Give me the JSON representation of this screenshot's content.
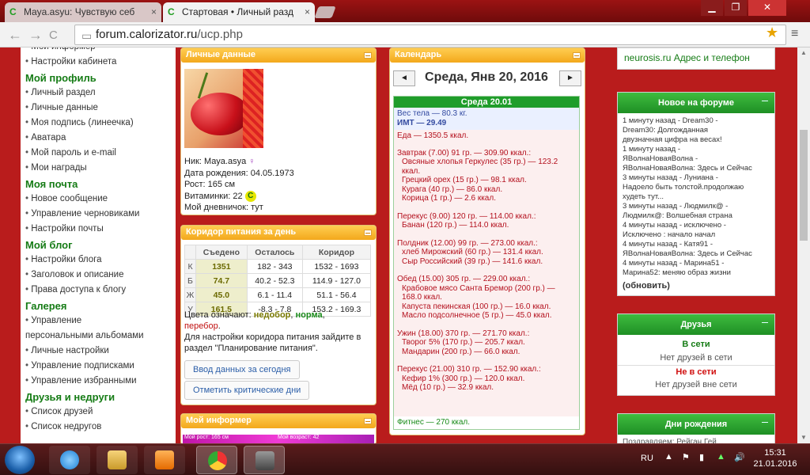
{
  "browser": {
    "tabs": [
      {
        "title": "Maya.asyu: Чувствую себ",
        "active": false
      },
      {
        "title": "Стартовая • Личный разд",
        "active": true
      }
    ],
    "url_domain": "forum.calorizator.ru",
    "url_path": "/ucp.php",
    "tab_close": "×",
    "fav_letter": "C",
    "minimize": "▁",
    "restore": "❐",
    "close": "✕",
    "back": "←",
    "forward": "→",
    "reload": "C",
    "star": "★",
    "menu": "≡",
    "page_icon": "▭"
  },
  "sidebar": {
    "items": [
      {
        "type": "item",
        "label": "Мой информер"
      },
      {
        "type": "item",
        "label": "Настройки кабинета"
      },
      {
        "type": "head",
        "label": "Мой профиль"
      },
      {
        "type": "item",
        "label": "Личный раздел"
      },
      {
        "type": "item",
        "label": "Личные данные"
      },
      {
        "type": "item",
        "label": "Моя подпись (линеечка)"
      },
      {
        "type": "item",
        "label": "Аватара"
      },
      {
        "type": "item",
        "label": "Мой пароль и e-mail"
      },
      {
        "type": "item",
        "label": "Мои награды"
      },
      {
        "type": "head",
        "label": "Моя почта"
      },
      {
        "type": "item",
        "label": "Новое сообщение"
      },
      {
        "type": "item",
        "label": "Управление черновиками"
      },
      {
        "type": "item",
        "label": "Настройки почты"
      },
      {
        "type": "head",
        "label": "Мой блог"
      },
      {
        "type": "item",
        "label": "Настройки блога"
      },
      {
        "type": "item",
        "label": "Заголовок и описание"
      },
      {
        "type": "item",
        "label": "Права доступа к блогу"
      },
      {
        "type": "head",
        "label": "Галерея"
      },
      {
        "type": "item",
        "label": "Управление"
      },
      {
        "type": "plain",
        "label": "персональными альбомами"
      },
      {
        "type": "item",
        "label": "Личные настройки"
      },
      {
        "type": "item",
        "label": "Управление подписками"
      },
      {
        "type": "item",
        "label": "Управление избранными"
      },
      {
        "type": "head",
        "label": "Друзья и недруги"
      },
      {
        "type": "item",
        "label": "Список друзей"
      },
      {
        "type": "item",
        "label": "Список недругов"
      }
    ]
  },
  "personal": {
    "title": "Личные данные",
    "nick_label": "Ник:",
    "nick": "Maya.asya",
    "fem": "♀",
    "birth_label": "Дата рождения:",
    "birth": "04.05.1973",
    "height_label": "Рост:",
    "height": "165 см",
    "vit_label": "Витаминки:",
    "vit": "22",
    "vit_icon": "C",
    "diary_label": "Мой дневничок:",
    "diary": "тут"
  },
  "corridor": {
    "title": "Коридор питания за день",
    "headers": [
      "",
      "Съедено",
      "Осталось",
      "Коридор"
    ],
    "rows": [
      {
        "k": "К",
        "eaten": "1351",
        "left": "182  -  343",
        "range": "1532  -  1693"
      },
      {
        "k": "Б",
        "eaten": "74.7",
        "left": "40.2  -  52.3",
        "range": "114.9  -  127.0"
      },
      {
        "k": "Ж",
        "eaten": "45.0",
        "left": "6.1  -  11.4",
        "range": "51.1  -  56.4"
      },
      {
        "k": "У",
        "eaten": "161.5",
        "left": "-8.3  -  7.8",
        "range": "153.2  -  169.3"
      }
    ],
    "legend_prefix": "Цвета означают: ",
    "under": "недобор",
    "sep": ", ",
    "norm": "норма",
    "sep2": ",",
    "over": "перебор",
    "dot": ".",
    "note": "Для настройки коридора питания зайдите в раздел \"Планирование питания\".",
    "btn1": "Ввод данных за сегодня",
    "btn2": "Отметить критические дни"
  },
  "informer": {
    "title": "Мой информер",
    "strip1": "Мой рост: 165 см",
    "strip2": "Мой возраст: 42"
  },
  "calendar": {
    "title": "Календарь",
    "prev": "◄",
    "next": "►",
    "date": "Среда, Янв 20, 2016",
    "day_head": "Среда 20.01",
    "weight": "Вес тела — 80.3 кг.",
    "imt": "ИМТ — 29.49",
    "food_total": "Еда — 1350.5 ккал.",
    "meals": [
      {
        "title": "Завтрак (7.00) 91 гр. — 309.90 ккал.:",
        "items": [
          "Овсяные хлопья Геркулес (35 гр.) — 123.2 ккал.",
          "Грецкий орех (15 гр.) — 98.1 ккал.",
          "Курага (40 гр.) — 86.0 ккал.",
          "Корица (1 гр.) — 2.6 ккал."
        ]
      },
      {
        "title": "Перекус (9.00) 120 гр. — 114.00 ккал.:",
        "items": [
          "Банан (120 гр.) — 114.0 ккал."
        ]
      },
      {
        "title": "Полдник (12.00) 99 гр. — 273.00 ккал.:",
        "items": [
          "хлеб Мирожский (60 гр.) — 131.4 ккал.",
          "Сыр Российский (39 гр.) — 141.6 ккал."
        ]
      },
      {
        "title": "Обед (15.00) 305 гр. — 229.00 ккал.:",
        "items": [
          "Крабовое мясо Санта Бремор (200 гр.) — 168.0 ккал.",
          "Капуста пекинская (100 гр.) — 16.0 ккал.",
          "Масло подсолнечное (5 гр.) — 45.0 ккал."
        ]
      },
      {
        "title": "Ужин (18.00) 370 гр. — 271.70 ккал.:",
        "items": [
          "Творог 5% (170 гр.) — 205.7 ккал.",
          "Мандарин (200 гр.) — 66.0 ккал."
        ]
      },
      {
        "title": "Перекус (21.00) 310 гр. — 152.90 ккал.:",
        "items": [
          "Кефир 1% (300 гр.) — 120.0 ккал.",
          "Мёд (10 гр.) — 32.9 ккал."
        ]
      }
    ],
    "fitness": "Фитнес — 270 ккал."
  },
  "right": {
    "topline": "neurosis.ru    Адрес и телефон",
    "forum_title": "Новое на форуме",
    "forum_text": "1 минуту назад - Dream30 -\nDream30: Долгожданная\nдвузначная цифра на весах!\n1 минуту назад -\nЯВолнаНоваяВолна -\nЯВолнаНоваяВолна: Здесь и Сейчас\n3 минуты назад - Луниана -\nНадоело быть толстой.продолжаю\nхудеть тут...\n3 минуты назад - Людмилк@ -\nЛюдмилк@: Волшебная страна\n4 минуты назад - исключено -\nИсключено : начало начал\n4 минуты назад - Катя91 -\nЯВолнаНоваяВолна: Здесь и Сейчас\n4 минуты назад - Марина51 -\nМарина52: меняю образ жизни",
    "forum_update": "(обновить)",
    "friends_title": "Друзья",
    "online": "В сети",
    "no_online": "Нет друзей в сети",
    "offline": "Не в сети",
    "no_offline": "Нет друзей вне сети",
    "bday_title": "Дни рождения",
    "bday_cut": "Поздравляем: Рейган Гей..."
  },
  "taskbar": {
    "lang": "RU",
    "time": "15:31",
    "date": "21.01.2016",
    "flag": "⚑",
    "vol": "🔊"
  },
  "colors": {
    "green": "#1f9d2a",
    "orange": "#f3a81b",
    "red_text": "#b4111e",
    "bg": "#b91c1c"
  }
}
